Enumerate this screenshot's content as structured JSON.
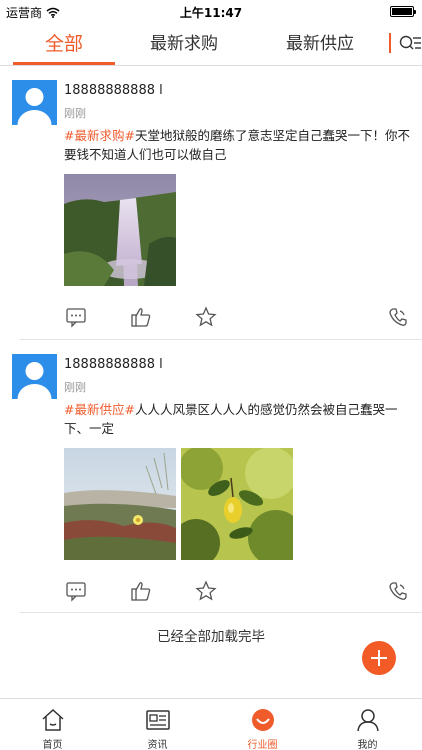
{
  "status_bar": {
    "carrier": "运营商",
    "time": "上午11:47"
  },
  "tabs": [
    {
      "label": "全部",
      "active": true
    },
    {
      "label": "最新求购",
      "active": false
    },
    {
      "label": "最新供应",
      "active": false
    }
  ],
  "posts": [
    {
      "username": "18888888888 l",
      "time": "刚刚",
      "tag": "#最新求购#",
      "text": "天堂地狱般的磨练了意志坚定自己蠢哭一下！你不要钱不知道人们也可以做自己"
    },
    {
      "username": "18888888888 l",
      "time": "刚刚",
      "tag": "#最新供应#",
      "text": "人人人风景区人人人的感觉仍然会被自己蠢哭一下、一定"
    }
  ],
  "load_status": "已经全部加载完毕",
  "bottom_nav": [
    {
      "label": "首页",
      "active": false
    },
    {
      "label": "资讯",
      "active": false
    },
    {
      "label": "行业圈",
      "active": true
    },
    {
      "label": "我的",
      "active": false
    }
  ],
  "colors": {
    "accent": "#ef5b2b",
    "avatar_bg": "#2c8ee8"
  },
  "icons": [
    "wifi-icon",
    "battery-icon",
    "filter-icon",
    "comment-icon",
    "like-icon",
    "favorite-icon",
    "phone-icon",
    "add-icon",
    "home-icon",
    "news-icon",
    "circle-icon",
    "profile-icon"
  ]
}
